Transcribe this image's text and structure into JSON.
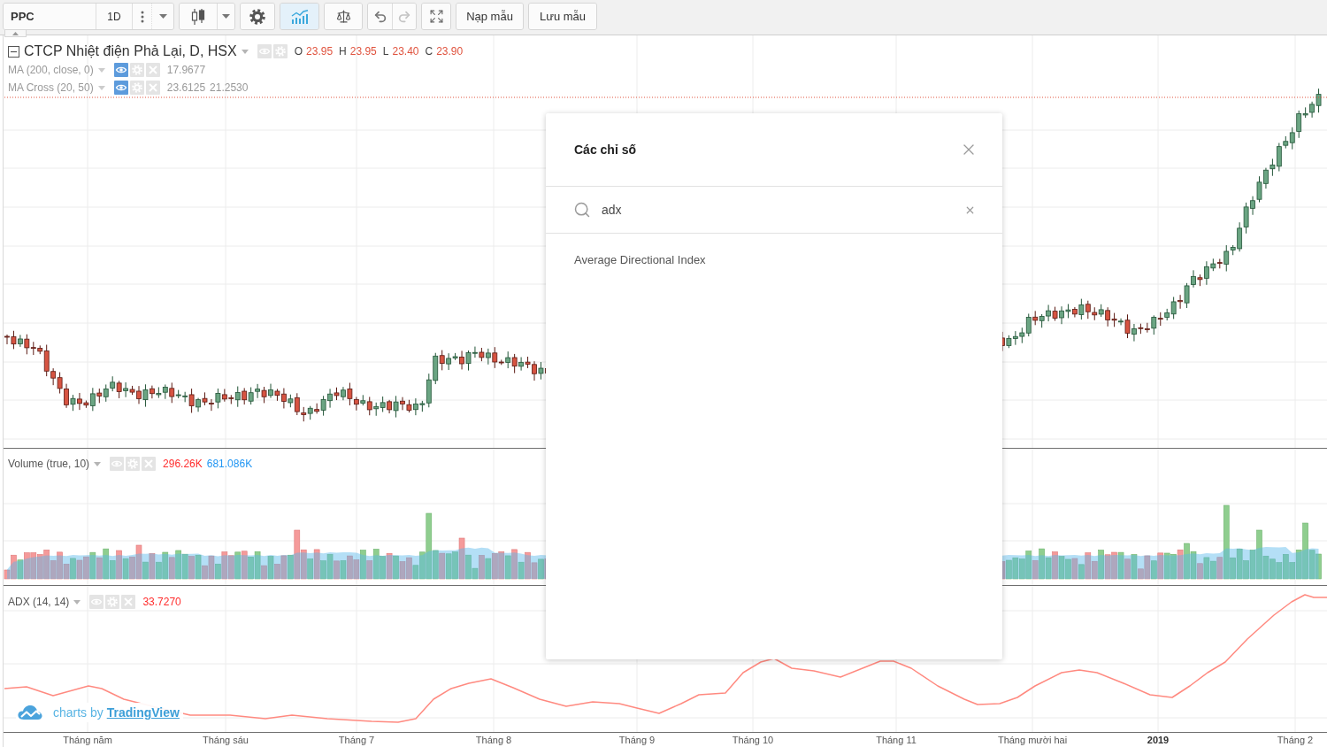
{
  "toolbar": {
    "symbol": {
      "value": "PPC"
    },
    "interval": {
      "label": "1D"
    },
    "indicators_button": {
      "active": true
    },
    "undo_button": {
      "disabled": false
    },
    "redo_button": {
      "disabled": true
    },
    "template_buttons": [
      {
        "label": "Nạp mẫu"
      },
      {
        "label": "Lưu mẫu"
      }
    ]
  },
  "panes": [
    {
      "kind": "price",
      "legends": [
        {
          "kind": "series",
          "title": "CTCP Nhiệt điện Phả Lại, D, HSX",
          "hidden": false,
          "ohlc": [
            {
              "label": "O",
              "value": "23.95"
            },
            {
              "label": "H",
              "value": "23.95"
            },
            {
              "label": "L",
              "value": "23.40"
            },
            {
              "label": "C",
              "value": "23.90"
            }
          ]
        },
        {
          "kind": "study",
          "title": "MA (200, close, 0)",
          "hidden": true,
          "values": [
            {
              "text": "17.9677"
            }
          ]
        },
        {
          "kind": "study",
          "title": "MA Cross (20, 50)",
          "hidden": true,
          "values": [
            {
              "text": "23.6125"
            },
            {
              "text": "21.2530"
            }
          ]
        }
      ]
    },
    {
      "kind": "volume",
      "legends": [
        {
          "kind": "study",
          "title": "Volume (true, 10)",
          "hidden": false,
          "values": [
            {
              "text": "296.26K",
              "color": "#ff2d2d"
            },
            {
              "text": "681.086K",
              "color": "#2196f3"
            }
          ]
        }
      ]
    },
    {
      "kind": "adx",
      "legends": [
        {
          "kind": "study",
          "title": "ADX (14, 14)",
          "hidden": false,
          "values": [
            {
              "text": "33.7270",
              "color": "#ff2d2d"
            }
          ]
        }
      ]
    }
  ],
  "time_axis": [
    {
      "label": "Tháng năm",
      "kind": "month"
    },
    {
      "label": "Tháng sáu",
      "kind": "month"
    },
    {
      "label": "Tháng 7",
      "kind": "month"
    },
    {
      "label": "Tháng 8",
      "kind": "month"
    },
    {
      "label": "Tháng 9",
      "kind": "month"
    },
    {
      "label": "Tháng 10",
      "kind": "month"
    },
    {
      "label": "Tháng 11",
      "kind": "month"
    },
    {
      "label": "Tháng mười hai",
      "kind": "month"
    },
    {
      "label": "2019",
      "kind": "year"
    },
    {
      "label": "Tháng 2",
      "kind": "month"
    }
  ],
  "attribution": {
    "text": "charts by",
    "link": "TradingView"
  },
  "dialog": {
    "title": "Các chỉ số",
    "search": {
      "value": "adx"
    },
    "results": [
      {
        "label": "Average Directional Index"
      }
    ]
  }
}
